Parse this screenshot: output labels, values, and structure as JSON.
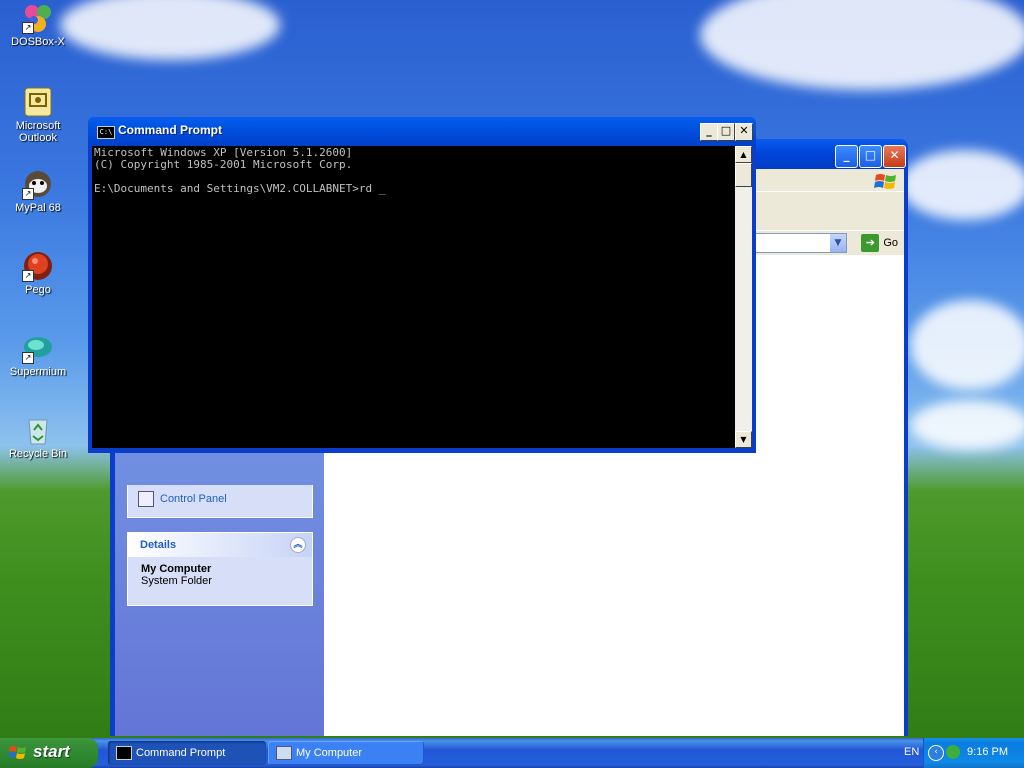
{
  "desktop": {
    "icons": [
      {
        "label": "DOSBox-X",
        "icon": "dosbox-icon"
      },
      {
        "label": "Microsoft Outlook",
        "icon": "outlook-icon"
      },
      {
        "label": "MyPal 68",
        "icon": "mypal-icon"
      },
      {
        "label": "Pego",
        "icon": "pego-icon"
      },
      {
        "label": "Supermium",
        "icon": "supermium-icon"
      },
      {
        "label": "Recycle Bin",
        "icon": "recycle-bin-icon"
      }
    ]
  },
  "cmd_window": {
    "title": "Command Prompt",
    "output": "Microsoft Windows XP [Version 5.1.2600]\n(C) Copyright 1985-2001 Microsoft Corp.\n\nE:\\Documents and Settings\\VM2.COLLABNET>rd _"
  },
  "mycomputer_window": {
    "address_go": "Go",
    "other_places_item": "Control Panel",
    "details": {
      "header": "Details",
      "name": "My Computer",
      "type": "System Folder"
    }
  },
  "taskbar": {
    "start_label": "start",
    "tasks": [
      {
        "label": "Command Prompt",
        "active": true
      },
      {
        "label": "My Computer",
        "active": false
      }
    ],
    "language": "EN",
    "clock": "9:16 PM"
  }
}
